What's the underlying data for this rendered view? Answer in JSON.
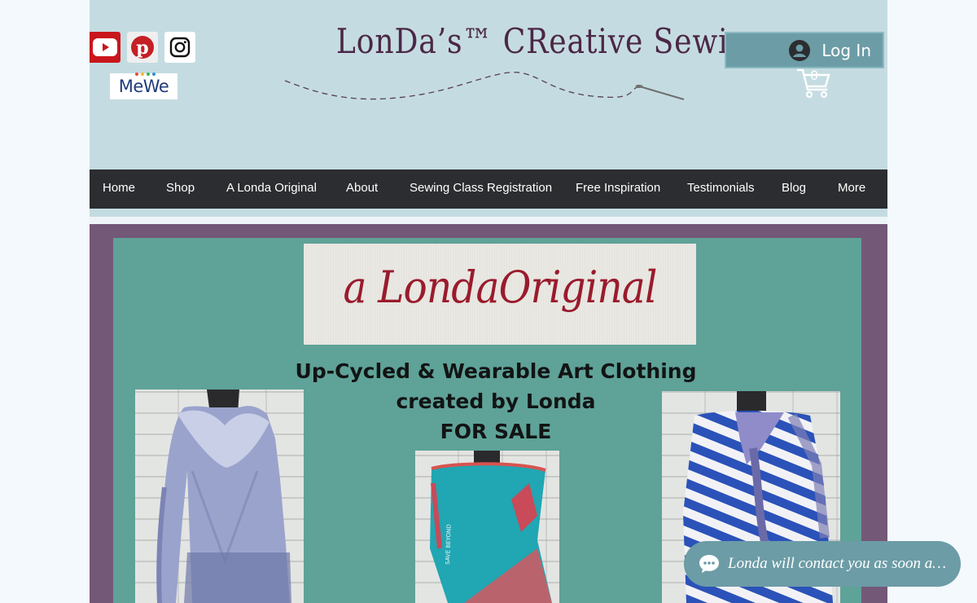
{
  "header": {
    "brand_title": "LonDa’s™ CReative Sewing",
    "login_label": "Log In",
    "cart_count": "0",
    "social": [
      "youtube-icon",
      "pinterest-icon",
      "instagram-icon"
    ],
    "mewe_label": "MeWe"
  },
  "nav": {
    "items": [
      "Home",
      "Shop",
      "A Londa Original",
      "About",
      "Sewing Class Registration",
      "Free Inspiration",
      "Testimonials",
      "Blog",
      "More"
    ]
  },
  "hero": {
    "label_text": "a LondaOriginal",
    "heading_line1": "Up-Cycled & Wearable Art Clothing",
    "heading_line2": "created by Londa",
    "heading_line3": "FOR SALE"
  },
  "chat": {
    "text": "Londa will contact you as soon a…"
  },
  "colors": {
    "header_bg": "#c4dce1",
    "nav_bg": "#2c2d30",
    "hero_frame": "#745877",
    "hero_inner": "#5fa298",
    "accent": "#6c9ca6"
  }
}
